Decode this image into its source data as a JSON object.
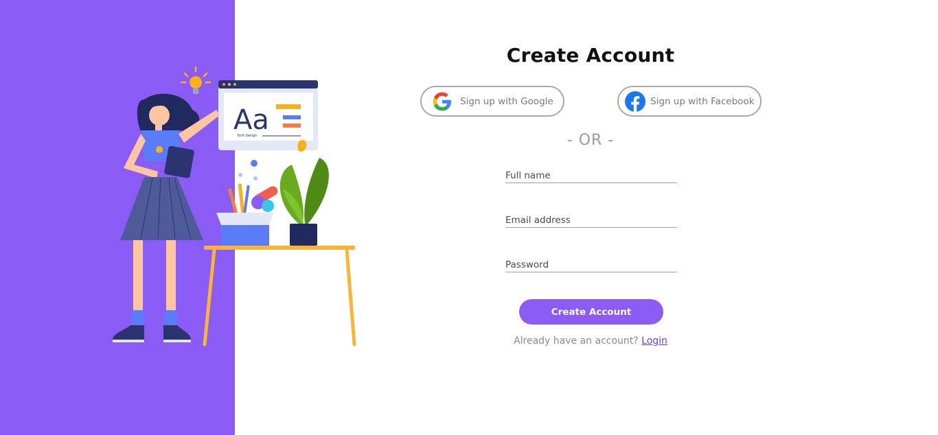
{
  "page": {
    "title": "Create Account"
  },
  "social": {
    "google_label": "Sign up with Google",
    "facebook_label": "Sign up with Facebook"
  },
  "divider": {
    "text": "- OR -"
  },
  "form": {
    "full_name_placeholder": "Full name",
    "email_placeholder": "Email address",
    "password_placeholder": "Password",
    "submit_label": "Create Account"
  },
  "footer": {
    "prompt": "Already have an account?",
    "login_label": "Login"
  },
  "illustration": {
    "letters": "Aa",
    "caption": "font design"
  },
  "colors": {
    "accent": "#8a5cf5",
    "link": "#6a3cf0",
    "google_blue": "#4285F4",
    "facebook_blue": "#1877F2"
  }
}
